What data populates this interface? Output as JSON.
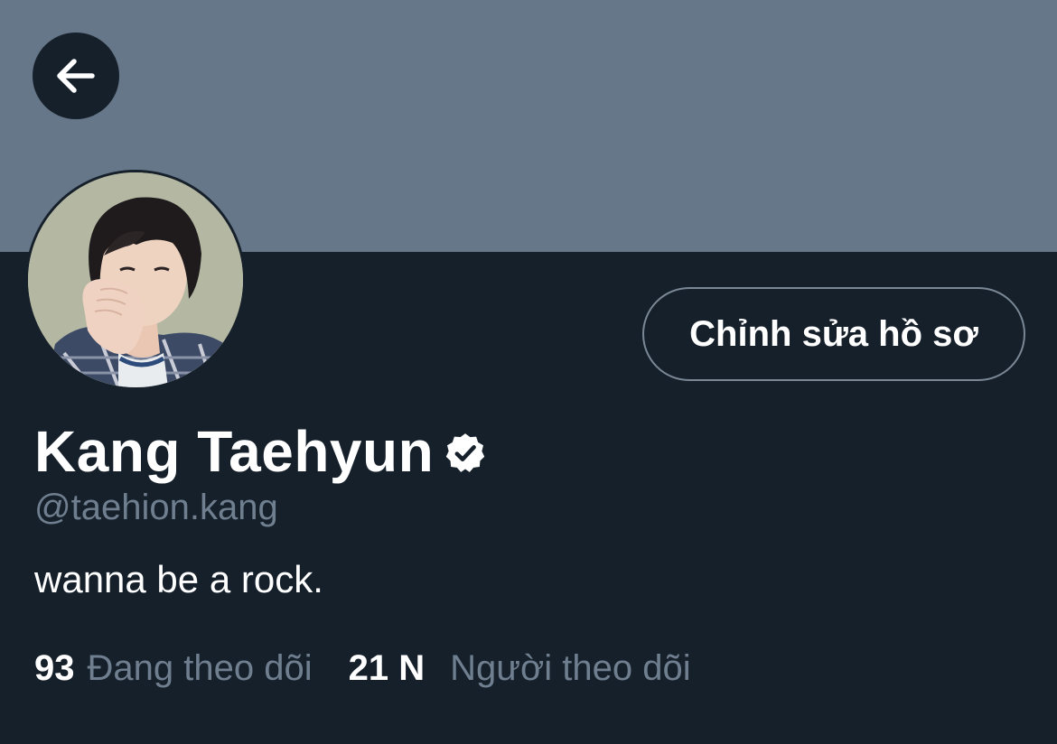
{
  "profile": {
    "display_name": "Kang Taehyun",
    "handle": "@taehion.kang",
    "bio": "wanna be a rock.",
    "verified_icon": "verified-badge-icon",
    "avatar": "profile-photo"
  },
  "header": {
    "back_icon": "arrow-left-icon",
    "edit_button_label": "Chỉnh sửa hồ sơ"
  },
  "stats": {
    "following_count": "93",
    "following_label": "Đang theo dõi",
    "followers_count": "21 N",
    "followers_label": "Người theo dõi"
  },
  "colors": {
    "banner": "#66778a",
    "background": "#16202b",
    "secondary_text": "#6f7f8f",
    "primary_text": "#ffffff"
  }
}
